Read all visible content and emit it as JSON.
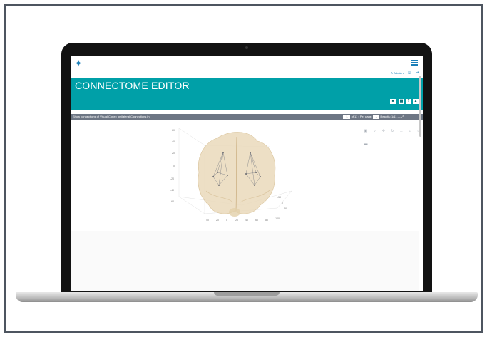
{
  "app": {
    "banner_title": "CONNECTOME EDITOR",
    "admin_label": "✎ Admin ▾",
    "brand_color": "#00a0a8",
    "link_color": "#1b7fb8"
  },
  "banner_buttons": [
    {
      "icon": "square-icon",
      "glyph": "■"
    },
    {
      "icon": "grid-icon",
      "glyph": "▦"
    },
    {
      "icon": "help-icon",
      "glyph": "?"
    },
    {
      "icon": "user-icon",
      "glyph": "▲"
    }
  ],
  "toolbar": {
    "label": "Show connections of Visual Cortex Ipsilateral Connections in",
    "prev": "‹",
    "page": "1",
    "of": "of 11",
    "next": "›",
    "per_page_label": "Per page:",
    "per_page_value": "1",
    "results": "Results: 1/11",
    "collapse": "—",
    "expand": "⤢"
  },
  "plot_tools": [
    {
      "icon": "camera-icon",
      "glyph": "▣"
    },
    {
      "icon": "zoom-icon",
      "glyph": "⌕"
    },
    {
      "icon": "pan-icon",
      "glyph": "✛"
    },
    {
      "icon": "rotate-icon",
      "glyph": "↻"
    },
    {
      "icon": "turntable-icon",
      "glyph": "⊥"
    },
    {
      "icon": "home-icon",
      "glyph": "⌂"
    },
    {
      "icon": "reset-icon",
      "glyph": "▭"
    },
    {
      "icon": "plotly-logo-icon",
      "glyph": "▬"
    }
  ],
  "axis_ticks": {
    "z": [
      "60",
      "40",
      "20",
      "0",
      "-20",
      "-40",
      "-60"
    ],
    "x": [
      "-50",
      "0",
      "50"
    ],
    "y": [
      "-100",
      "-80",
      "-60",
      "-40",
      "-20",
      "0",
      "20",
      "40"
    ]
  }
}
